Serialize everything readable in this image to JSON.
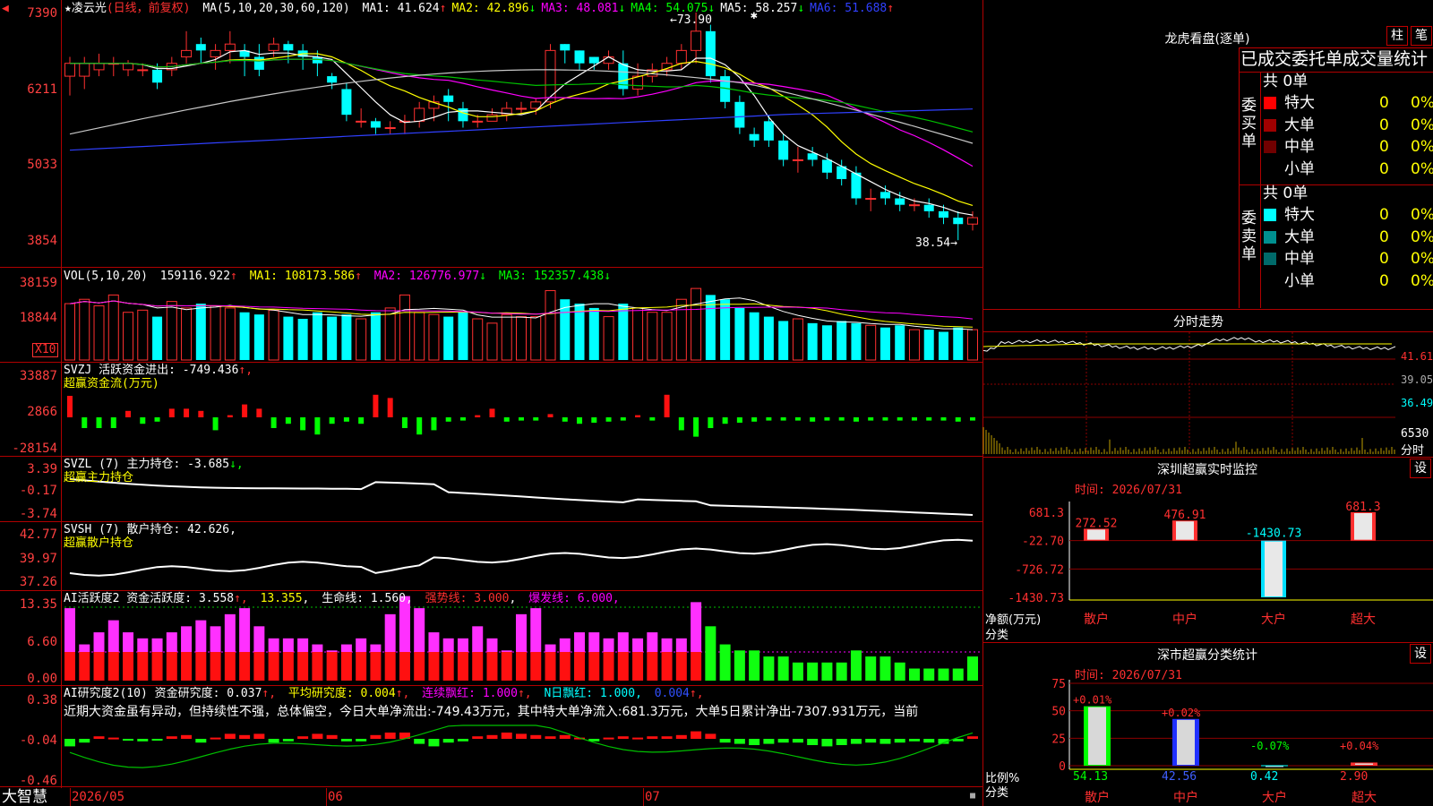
{
  "stock": {
    "name": "凌云光",
    "mode": "(日线，前复权)"
  },
  "ma_line": {
    "label": "MA(5,10,20,30,60,120)",
    "items": [
      {
        "label": "MA1: 41.624",
        "arrow": "↑",
        "color": "#ffffff",
        "arrow_color": "#ff3030"
      },
      {
        "label": "MA2: 42.896",
        "arrow": "↓",
        "color": "#ffff00",
        "arrow_color": "#00ff00"
      },
      {
        "label": "MA3: 48.081",
        "arrow": "↓",
        "color": "#ff00ff",
        "arrow_color": "#00ff00"
      },
      {
        "label": "MA4: 54.075",
        "arrow": "↓",
        "color": "#00ff00",
        "arrow_color": "#00ff00"
      },
      {
        "label": "MA5: 58.257",
        "arrow": "↓",
        "color": "#ffffff",
        "arrow_color": "#00ff00"
      },
      {
        "label": "MA6: 51.688",
        "arrow": "↑",
        "color": "#3040ff",
        "arrow_color": "#ff3030"
      }
    ]
  },
  "price_axis": [
    "7390",
    "6211",
    "5033",
    "3854"
  ],
  "price_high_label": "73.90",
  "price_low_label": "38.54",
  "vol": {
    "title": "VOL(5,10,20)",
    "value": "159116.922",
    "ma1": "MA1: 108173.586",
    "ma2": "MA2: 126776.977",
    "ma3": "MA3: 152357.438",
    "axis": [
      "38159",
      "18844"
    ],
    "unit": "X10"
  },
  "svzj": {
    "title": "SVZJ  活跃资金进出: -749.436",
    "sub": "超赢资金流(万元)",
    "axis": [
      "33887",
      "2866",
      "-28154"
    ]
  },
  "svzl": {
    "title": "SVZL (7) 主力持仓: -3.685",
    "sub": "超赢主力持仓",
    "axis": [
      "3.39",
      "-0.17",
      "-3.74"
    ]
  },
  "svsh": {
    "title": "SVSH (7) 散户持仓: 42.626",
    "sub": "超赢散户持仓",
    "axis": [
      "42.77",
      "39.97",
      "37.26"
    ]
  },
  "ai1": {
    "title": "AI活跃度2 资金活跃度: 3.558",
    "v2": "13.355",
    "life": "生命线: 1.560",
    "strong": "强势线: 3.000",
    "burst": "爆发线: 6.000",
    "axis": [
      "13.35",
      "6.60",
      "0.00"
    ]
  },
  "ai2": {
    "title": "AI研究度2(10) 资金研究度: 0.037",
    "avg": "平均研究度: 0.004",
    "cont": "连续飘红: 1.000",
    "nday": "N日飘红: 1.000",
    "last": "0.004",
    "note": "近期大资金虽有异动，但持续性不强，总体偏空，今日大单净流出:-749.43万元，其中特大单净流入:681.3万元，大单5日累计净出-7307.931万元，当前",
    "axis": [
      "0.38",
      "-0.04",
      "-0.46"
    ]
  },
  "bottom": {
    "brand": "大智慧",
    "dates": [
      "2026/05",
      "06",
      "07"
    ]
  },
  "lhb": {
    "title": "龙虎看盘(逐单)",
    "btn1": "柱",
    "btn2": "笔",
    "tabs": "已成交委托单成交量统计",
    "buy_label": "委买单",
    "sell_label": "委卖单",
    "buy_total": "共 0单",
    "sell_total": "共 0单",
    "buy_rows": [
      {
        "name": "特大",
        "count": "0",
        "pct": "0%",
        "color": "#ff0000"
      },
      {
        "name": "大单",
        "count": "0",
        "pct": "0%",
        "color": "#a00000"
      },
      {
        "name": "中单",
        "count": "0",
        "pct": "0%",
        "color": "#700000"
      },
      {
        "name": "小单",
        "count": "0",
        "pct": "0%",
        "color": ""
      }
    ],
    "sell_rows": [
      {
        "name": "特大",
        "count": "0",
        "pct": "0%",
        "color": "#00ffff"
      },
      {
        "name": "大单",
        "count": "0",
        "pct": "0%",
        "color": "#009090"
      },
      {
        "name": "中单",
        "count": "0",
        "pct": "0%",
        "color": "#006a6a"
      },
      {
        "name": "小单",
        "count": "0",
        "pct": "0%",
        "color": ""
      }
    ]
  },
  "fenshi": {
    "title": "分时走势",
    "axis": [
      "41.61",
      "39.05",
      "36.49"
    ],
    "vol_axis": [
      "6530",
      "分时"
    ]
  },
  "monitor": {
    "title": "深圳超赢实时监控",
    "btn": "设",
    "time": "时间: 2026/07/31",
    "axis": [
      "681.3",
      "-22.70",
      "-726.72",
      "-1430.73"
    ],
    "ylabel1": "净额(万元)",
    "ylabel2": "分类",
    "values": [
      "272.52",
      "476.91",
      "-1430.73",
      "681.3"
    ],
    "cats": [
      "散户",
      "中户",
      "大户",
      "超大"
    ]
  },
  "classify": {
    "title": "深市超赢分类统计",
    "btn": "设",
    "time": "时间: 2026/07/31",
    "axis": [
      "75",
      "50",
      "25",
      "0"
    ],
    "ylabel1": "比例%",
    "ylabel2": "分类",
    "pcts": [
      "+0.01%",
      "+0.02%",
      "-0.07%",
      "+0.04%"
    ],
    "vals": [
      "54.13",
      "42.56",
      "0.42",
      "2.90"
    ],
    "cats": [
      "散户",
      "中户",
      "大户",
      "超大"
    ]
  },
  "chart_data": {
    "type": "bar",
    "title": "深圳超赢实时监控",
    "ylabel": "净额(万元)",
    "xlabel": "分类",
    "categories": [
      "散户",
      "中户",
      "大户",
      "超大"
    ],
    "values": [
      272.52,
      476.91,
      -1430.73,
      681.3
    ],
    "ylim": [
      -1430.73,
      681.3
    ],
    "secondary": {
      "title": "深市超赢分类统计",
      "ylabel": "比例%",
      "categories": [
        "散户",
        "中户",
        "大户",
        "超大"
      ],
      "values": [
        54.13,
        42.56,
        0.42,
        2.9
      ],
      "changes": [
        "+0.01%",
        "+0.02%",
        "-0.07%",
        "+0.04%"
      ],
      "ylim": [
        0,
        75
      ]
    }
  }
}
